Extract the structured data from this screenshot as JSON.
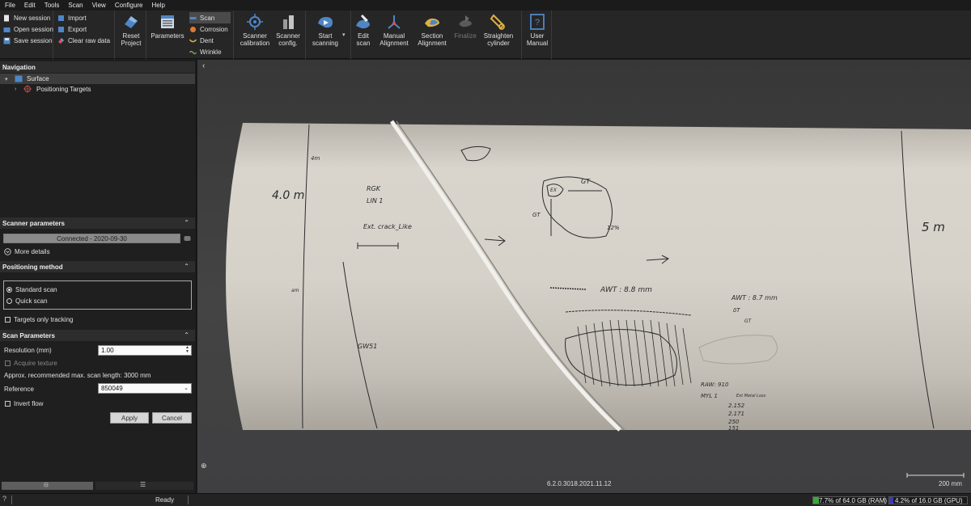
{
  "menu": [
    "File",
    "Edit",
    "Tools",
    "Scan",
    "View",
    "Configure",
    "Help"
  ],
  "ribbon": {
    "session": {
      "new": "New session",
      "open": "Open session",
      "save": "Save session"
    },
    "data": {
      "import": "Import",
      "export": "Export",
      "clear": "Clear raw data"
    },
    "reset": [
      "Reset",
      "Project"
    ],
    "parameters": "Parameters",
    "modes": {
      "scan": "Scan",
      "corrosion": "Corrosion",
      "dent": "Dent",
      "wrinkle": "Wrinkle"
    },
    "scanner_calibration": [
      "Scanner",
      "calibration"
    ],
    "scanner_config": [
      "Scanner",
      "config."
    ],
    "start_scanning": [
      "Start",
      "scanning"
    ],
    "edit_scan": [
      "Edit",
      "scan"
    ],
    "manual_alignment": [
      "Manual",
      "Alignment"
    ],
    "section_alignment": [
      "Section",
      "Alignment"
    ],
    "finalize": "Finalize",
    "straighten": [
      "Straighten",
      "cylinder"
    ],
    "user_manual": [
      "User",
      "Manual"
    ]
  },
  "navigation": {
    "title": "Navigation",
    "items": [
      "Surface",
      "Positioning Targets"
    ]
  },
  "scanner_parameters": {
    "title": "Scanner parameters",
    "status": "Connected - 2020-09-30",
    "more_details": "More details"
  },
  "positioning_method": {
    "title": "Positioning method",
    "options": [
      "Standard scan",
      "Quick scan"
    ],
    "selected_index": 0,
    "targets_only": "Targets only tracking"
  },
  "scan_parameters": {
    "title": "Scan Parameters",
    "resolution_label": "Resolution (mm)",
    "resolution_value": "1.00",
    "acquire_texture": "Acquire texture",
    "approx_length": "Approx. recommended max. scan length: 3000 mm",
    "reference_label": "Reference",
    "reference_value": "850049",
    "invert_flow": "Invert flow",
    "apply": "Apply",
    "cancel": "Cancel"
  },
  "viewport": {
    "version": "6.2.0.3018.2021.11.12",
    "scale_label": "200 mm",
    "markings": {
      "m40": "4.0 m",
      "m4": "4m",
      "m5": "5 m",
      "rgk": "RGK",
      "lin": "LIN 1",
      "crack": "Ext. crack_Like",
      "gt_top": "GT",
      "gt_left": "GT",
      "ex": "EX",
      "pct": "12%",
      "awt1": "AWT : 8.8 mm",
      "awt2": "AWT : 8.7 mm",
      "dt": "δT",
      "gt_small": "GT",
      "am": "am",
      "gw": "GW51",
      "raw": "RAW: 910",
      "myl": "MYL 1",
      "ext": "Ext Metal Loss",
      "v1": "2.152",
      "v2": "2.171",
      "v3": "250",
      "v4": "151"
    }
  },
  "status": {
    "ready": "Ready",
    "ram": "7.7% of 64.0 GB (RAM)",
    "ram_pct": 7.7,
    "gpu": "4.2% of 16.0 GB (GPU)",
    "gpu_pct": 4.2
  }
}
